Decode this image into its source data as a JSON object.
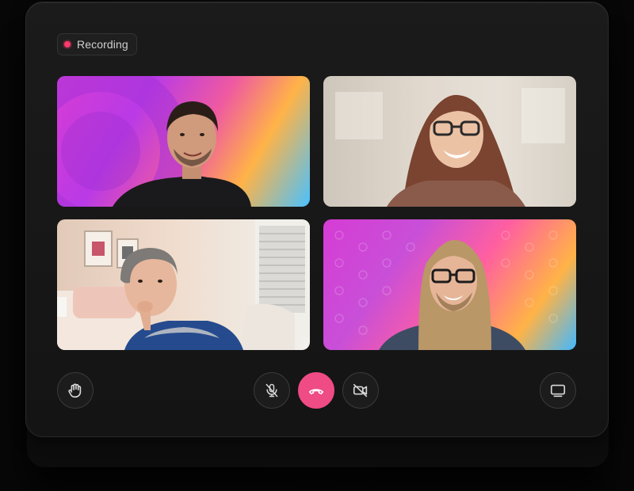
{
  "recording": {
    "label": "Recording",
    "dot_color": "#ff3b6b"
  },
  "participants": [
    {
      "name": "participant-1",
      "background": "gradient"
    },
    {
      "name": "participant-2",
      "background": "room"
    },
    {
      "name": "participant-3",
      "background": "bedroom"
    },
    {
      "name": "participant-4",
      "background": "gradient"
    }
  ],
  "controls": {
    "raise_hand_icon": "hand-icon",
    "mute_icon": "mic-off-icon",
    "end_call_icon": "phone-hangup-icon",
    "camera_icon": "video-off-icon",
    "screen_share_icon": "monitor-icon",
    "end_call_color": "#ef4b84"
  }
}
